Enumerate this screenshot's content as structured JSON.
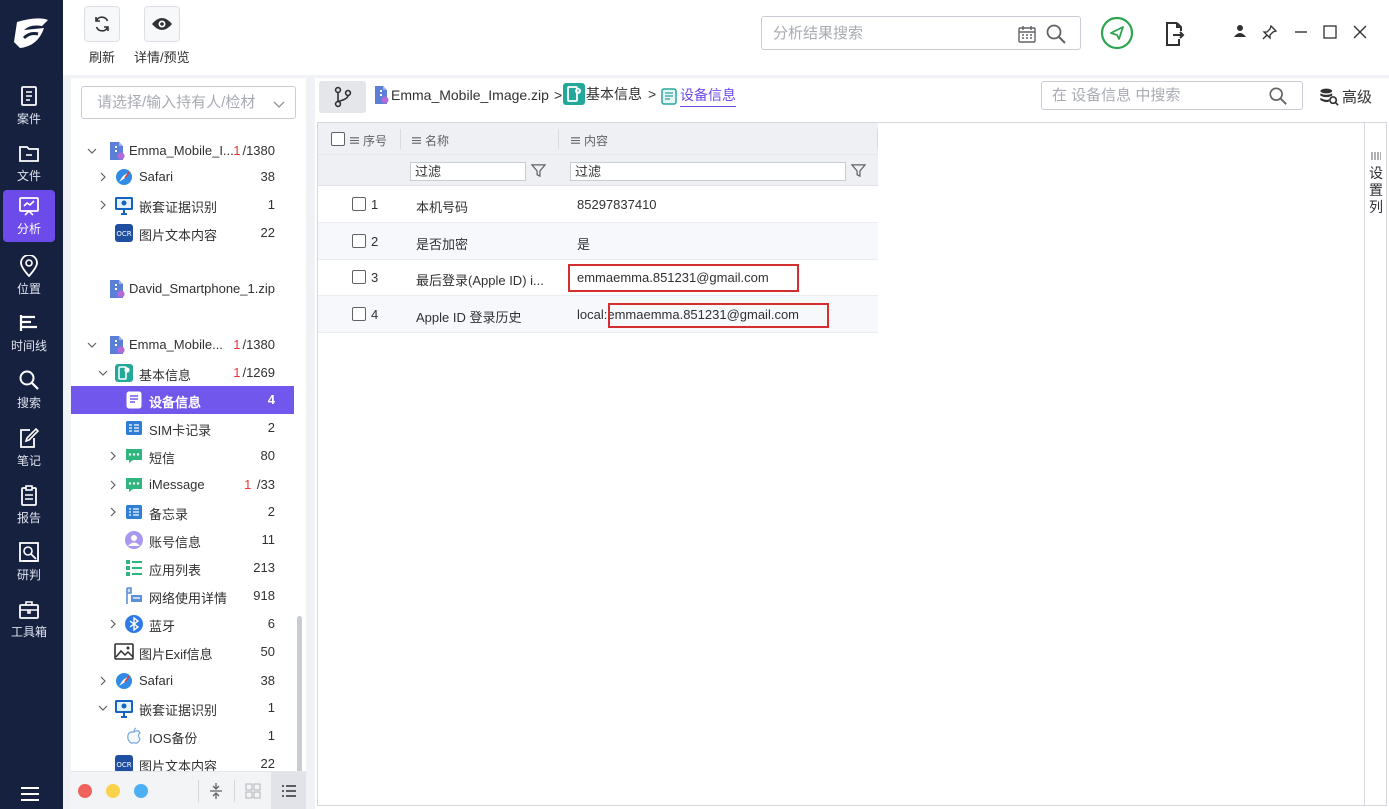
{
  "nav": {
    "items": [
      {
        "label": "案件",
        "icon": "case-icon"
      },
      {
        "label": "文件",
        "icon": "folder-icon"
      },
      {
        "label": "分析",
        "icon": "analysis-icon",
        "active": true
      },
      {
        "label": "位置",
        "icon": "location-pin-icon"
      },
      {
        "label": "时间线",
        "icon": "timeline-icon"
      },
      {
        "label": "搜索",
        "icon": "search-icon"
      },
      {
        "label": "笔记",
        "icon": "note-icon"
      },
      {
        "label": "报告",
        "icon": "report-icon"
      },
      {
        "label": "研判",
        "icon": "research-icon"
      },
      {
        "label": "工具箱",
        "icon": "toolbox-icon"
      }
    ]
  },
  "toolbar": {
    "refresh_label": "刷新",
    "details_label": "详情/预览",
    "search_placeholder": "分析结果搜索"
  },
  "left_panel": {
    "owner_placeholder": "请选择/输入持有人/检材",
    "tree": [
      {
        "label": "Emma_Mobile_I...",
        "count_red": "1",
        "count": "/1380",
        "icon": "zip-file-icon",
        "level": 0,
        "chevron": "down"
      },
      {
        "label": "Safari",
        "count_red": "",
        "count": "38",
        "icon": "safari-icon",
        "level": 1,
        "chevron": "right"
      },
      {
        "label": "嵌套证据识别",
        "count_red": "",
        "count": "1",
        "icon": "monitor-icon",
        "level": 1,
        "chevron": "right"
      },
      {
        "label": "图片文本内容",
        "count_red": "",
        "count": "22",
        "icon": "ocr-icon",
        "level": 1,
        "chevron": ""
      },
      {
        "label": "David_Smartphone_1.zip",
        "count_red": "",
        "count": "",
        "icon": "zip-file-icon",
        "level": 0,
        "chevron": ""
      },
      {
        "label": "Emma_Mobile...",
        "count_red": "1",
        "count": "/1380",
        "icon": "zip-file-icon",
        "level": 0,
        "chevron": "down"
      },
      {
        "label": "基本信息",
        "count_red": "1",
        "count": "/1269",
        "icon": "basic-info-icon",
        "level": 1,
        "chevron": "down"
      },
      {
        "label": "设备信息",
        "count_red": "",
        "count": "4",
        "icon": "device-info-icon",
        "level": 2,
        "chevron": "",
        "selected": true
      },
      {
        "label": "SIM卡记录",
        "count_red": "",
        "count": "2",
        "icon": "sim-card-icon",
        "level": 2,
        "chevron": ""
      },
      {
        "label": "短信",
        "count_red": "",
        "count": "80",
        "icon": "sms-icon",
        "level": 2,
        "chevron": "right"
      },
      {
        "label": "iMessage",
        "count_red": "1",
        "count": " /33",
        "icon": "imessage-icon",
        "level": 2,
        "chevron": "right"
      },
      {
        "label": "备忘录",
        "count_red": "",
        "count": "2",
        "icon": "memo-icon",
        "level": 2,
        "chevron": "right"
      },
      {
        "label": "账号信息",
        "count_red": "",
        "count": "11",
        "icon": "account-icon",
        "level": 2,
        "chevron": ""
      },
      {
        "label": "应用列表",
        "count_red": "",
        "count": "213",
        "icon": "app-list-icon",
        "level": 2,
        "chevron": ""
      },
      {
        "label": "网络使用详情",
        "count_red": "",
        "count": "918",
        "icon": "network-icon",
        "level": 2,
        "chevron": ""
      },
      {
        "label": "蓝牙",
        "count_red": "",
        "count": "6",
        "icon": "bluetooth-icon",
        "level": 2,
        "chevron": "right"
      },
      {
        "label": "图片Exif信息",
        "count_red": "",
        "count": "50",
        "icon": "image-icon",
        "level": 1,
        "chevron": ""
      },
      {
        "label": "Safari",
        "count_red": "",
        "count": "38",
        "icon": "safari-icon",
        "level": 1,
        "chevron": "right"
      },
      {
        "label": "嵌套证据识别",
        "count_red": "",
        "count": "1",
        "icon": "monitor-icon",
        "level": 1,
        "chevron": "down"
      },
      {
        "label": "IOS备份",
        "count_red": "",
        "count": "1",
        "icon": "apple-icon",
        "level": 2,
        "chevron": ""
      },
      {
        "label": "图片文本内容",
        "count_red": "",
        "count": "22",
        "icon": "ocr-icon",
        "level": 1,
        "chevron": ""
      }
    ]
  },
  "breadcrumb": {
    "items": [
      "Emma_Mobile_Image.zip",
      "基本信息",
      "设备信息"
    ],
    "separator": ">"
  },
  "main": {
    "search_placeholder": "在 设备信息 中搜索",
    "advanced_label": "高级",
    "settings_column_label": "设置列"
  },
  "table": {
    "columns": [
      "序号",
      "名称",
      "内容"
    ],
    "filter_placeholder": "过滤",
    "rows": [
      {
        "index": "1",
        "name": "本机号码",
        "content": "85297837410"
      },
      {
        "index": "2",
        "name": "是否加密",
        "content": "是"
      },
      {
        "index": "3",
        "name": "最后登录(Apple ID) i...",
        "content": "emmaemma.851231@gmail.com"
      },
      {
        "index": "4",
        "name": "Apple ID 登录历史",
        "content": "local:emmaemma.851231@gmail.com"
      }
    ]
  },
  "colors": {
    "nav_bg": "#16213f",
    "accent": "#6d4bea",
    "selected_row": "#7257ec",
    "highlight_border": "#d32f2f",
    "warning_red": "#e53935",
    "ok_green": "#2ea44f"
  }
}
